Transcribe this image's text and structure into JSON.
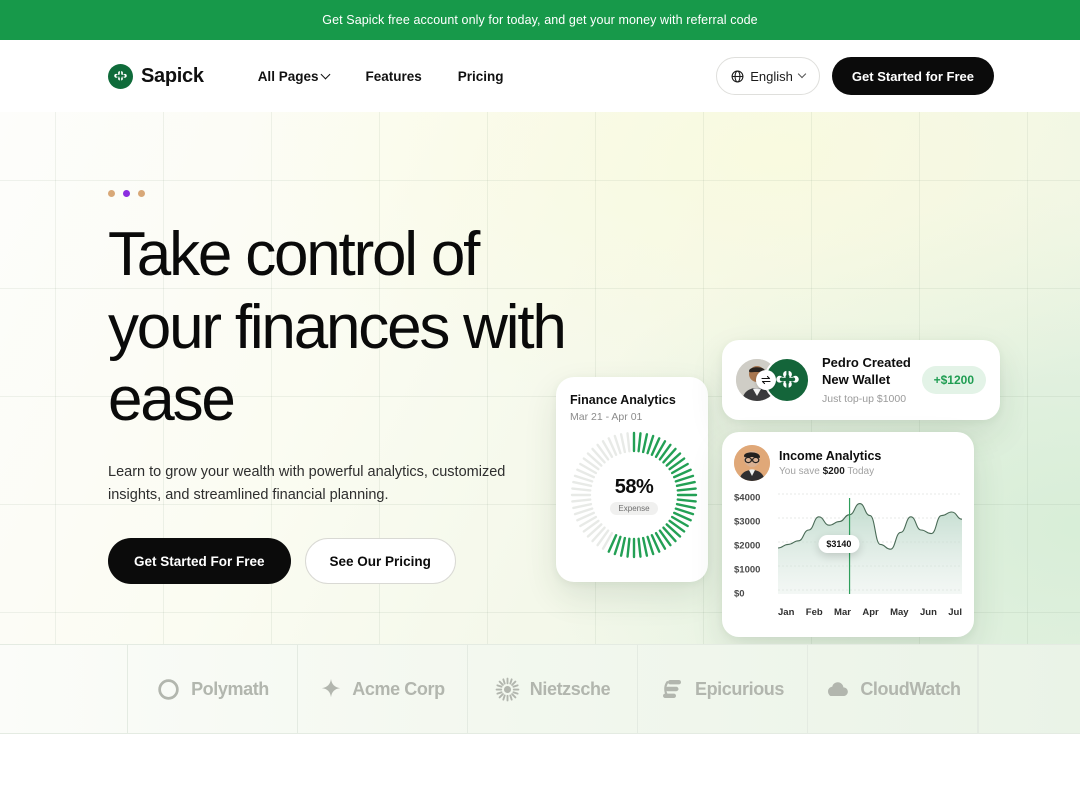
{
  "banner": {
    "text": "Get Sapick free account only for today, and get your money with referral code",
    "bg": "#17994a"
  },
  "nav": {
    "brand": "Sapick",
    "brand_icon": "clover-logo-icon",
    "links": [
      {
        "label": "All Pages",
        "has_dropdown": true
      },
      {
        "label": "Features",
        "has_dropdown": false
      },
      {
        "label": "Pricing",
        "has_dropdown": false
      }
    ],
    "language": {
      "label": "English",
      "icon": "globe-icon"
    },
    "cta": "Get Started for Free"
  },
  "hero": {
    "dots": [
      {
        "color": "#d8a878"
      },
      {
        "color": "#8b2ee0"
      },
      {
        "color": "#d8a878"
      }
    ],
    "headline": "Take control of your finances with ease",
    "subcopy": "Learn to grow your wealth with powerful analytics, customized insights, and streamlined financial planning.",
    "primary_cta": "Get Started For Free",
    "secondary_cta": "See Our Pricing"
  },
  "finance_card": {
    "title": "Finance Analytics",
    "date_range": "Mar 21 - Apr 01",
    "percent": "58%",
    "label": "Expense"
  },
  "pedro_card": {
    "title_line1": "Pedro Created",
    "title_line2": "New Wallet",
    "subtitle": "Just top-up $1000",
    "amount": "+$1200",
    "avatar_icon": "user-avatar",
    "wallet_icon": "clover-logo-icon",
    "swap_icon": "exchange-arrows-icon"
  },
  "income_card": {
    "title": "Income Analytics",
    "sub_prefix": "You save ",
    "sub_amount": "$200",
    "sub_suffix": " Today",
    "tooltip": "$3140",
    "avatar_icon": "user-avatar"
  },
  "chart_data": {
    "type": "area",
    "title": "Income Analytics",
    "x": [
      "Jan",
      "Feb",
      "Mar",
      "Apr",
      "May",
      "Jun",
      "Jul"
    ],
    "xlabel": "",
    "ylabel": "",
    "ylim": [
      0,
      4000
    ],
    "yticks": [
      "$0",
      "$1000",
      "$2000",
      "$3000",
      "$4000"
    ],
    "ytick_values": [
      0,
      1000,
      2000,
      3000,
      4000
    ],
    "grid": true,
    "legend": "none",
    "annotation": {
      "label": "$3140",
      "x": "Mar",
      "value": 3140
    },
    "series": [
      {
        "name": "Income",
        "values": [
          1750,
          1900,
          2050,
          2500,
          3050,
          2700,
          2850,
          3140,
          3600,
          3100,
          1900,
          1700,
          2400,
          3050,
          2500,
          2350,
          3100,
          3250,
          2950
        ]
      }
    ]
  },
  "logos": [
    {
      "name": "Polymath",
      "icon": "ring-icon"
    },
    {
      "name": "Acme Corp",
      "icon": "sparkle-star-icon"
    },
    {
      "name": "Nietzsche",
      "icon": "sunburst-icon"
    },
    {
      "name": "Epicurious",
      "icon": "stacked-bars-icon"
    },
    {
      "name": "CloudWatch",
      "icon": "cloud-icon"
    }
  ],
  "donut": {
    "filled_percent": 58,
    "total_ticks": 60,
    "fill_color": "#23a055",
    "track_color": "#e8eae7"
  }
}
